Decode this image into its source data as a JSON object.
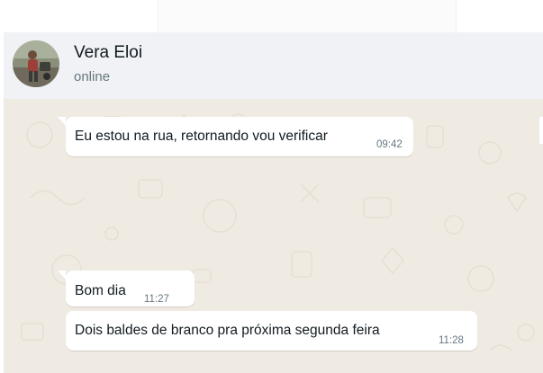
{
  "top_bar": {},
  "header": {
    "contact_name": "Vera Eloi",
    "status": "online",
    "avatar_icon": "contact-photo"
  },
  "messages": [
    {
      "text": "Eu estou na rua, retornando vou verificar",
      "time": "09:42",
      "direction": "incoming"
    },
    {
      "text": "Bom dia",
      "time": "11:27",
      "direction": "incoming"
    },
    {
      "text": "Dois baldes de branco pra próxima segunda feira",
      "time": "11:28",
      "direction": "incoming"
    }
  ],
  "colors": {
    "header_bg": "#f0f2f5",
    "chat_bg": "#efeae2",
    "bubble_bg": "#ffffff",
    "text_primary": "#111b21",
    "text_secondary": "#667781"
  }
}
